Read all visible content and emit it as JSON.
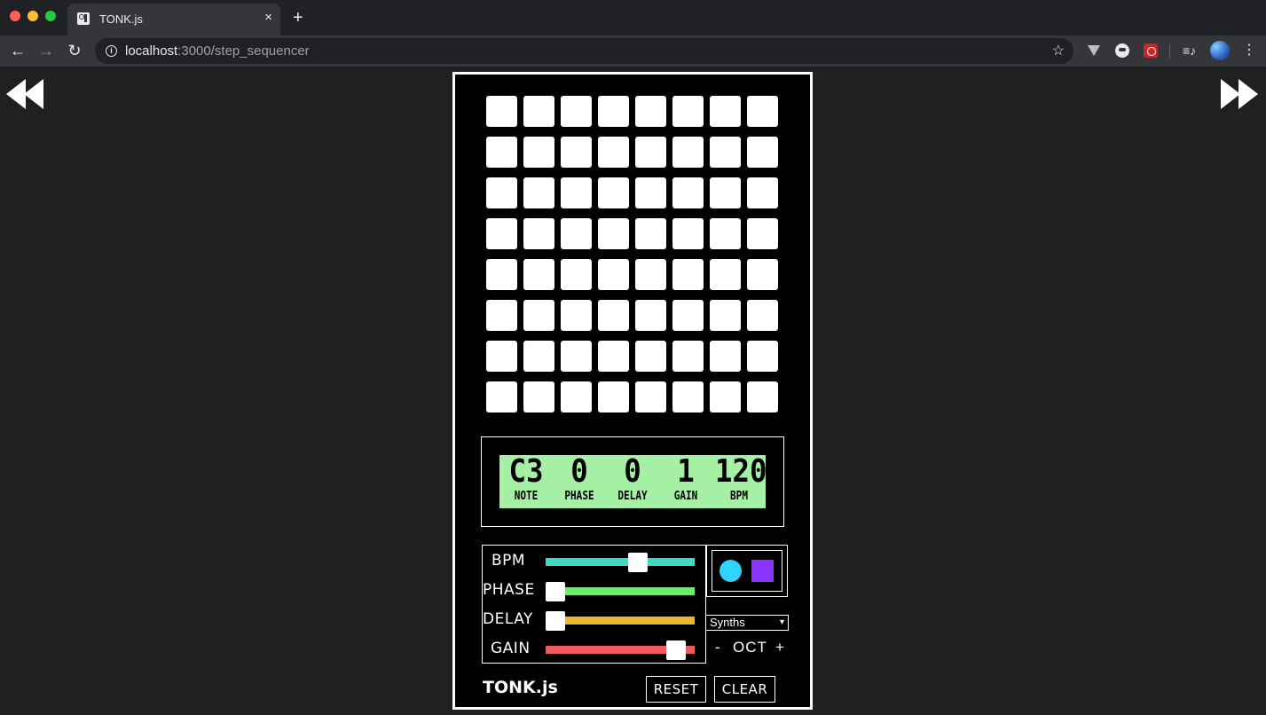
{
  "browser": {
    "tab_title": "TONK.js",
    "tab_close": "×",
    "new_tab": "+",
    "url_host": "localhost",
    "url_rest": ":3000/step_sequencer",
    "back_glyph": "←",
    "forward_glyph": "→",
    "reload_glyph": "↻",
    "star_glyph": "☆",
    "menu_glyph": "⋮",
    "playlist_glyph": "≡♪",
    "info_glyph": "i"
  },
  "sequencer": {
    "rows": 8,
    "cols": 8,
    "pad_color": "#ffffff"
  },
  "display": {
    "background": "#a5f0a5",
    "readouts": [
      {
        "value": "C3",
        "label": "NOTE"
      },
      {
        "value": "0",
        "label": "PHASE"
      },
      {
        "value": "0",
        "label": "DELAY"
      },
      {
        "value": "1",
        "label": "GAIN"
      },
      {
        "value": "120",
        "label": "BPM"
      }
    ]
  },
  "sliders": [
    {
      "label": "BPM",
      "color": "#3fd9c4",
      "level": 0.64
    },
    {
      "label": "PHASE",
      "color": "#6ee86e",
      "level": 0.0
    },
    {
      "label": "DELAY",
      "color": "#e8b92e",
      "level": 0.0
    },
    {
      "label": "GAIN",
      "color": "#f05a5a",
      "level": 0.93
    }
  ],
  "shapes": {
    "circle_color": "#30d2ff",
    "square_color": "#8a33ff"
  },
  "instrument": {
    "selected": "Synths",
    "oct_minus": "-",
    "oct_label": "OCT",
    "oct_plus": "+"
  },
  "footer": {
    "brand": "TONK.js",
    "reset_label": "RESET",
    "clear_label": "CLEAR"
  }
}
